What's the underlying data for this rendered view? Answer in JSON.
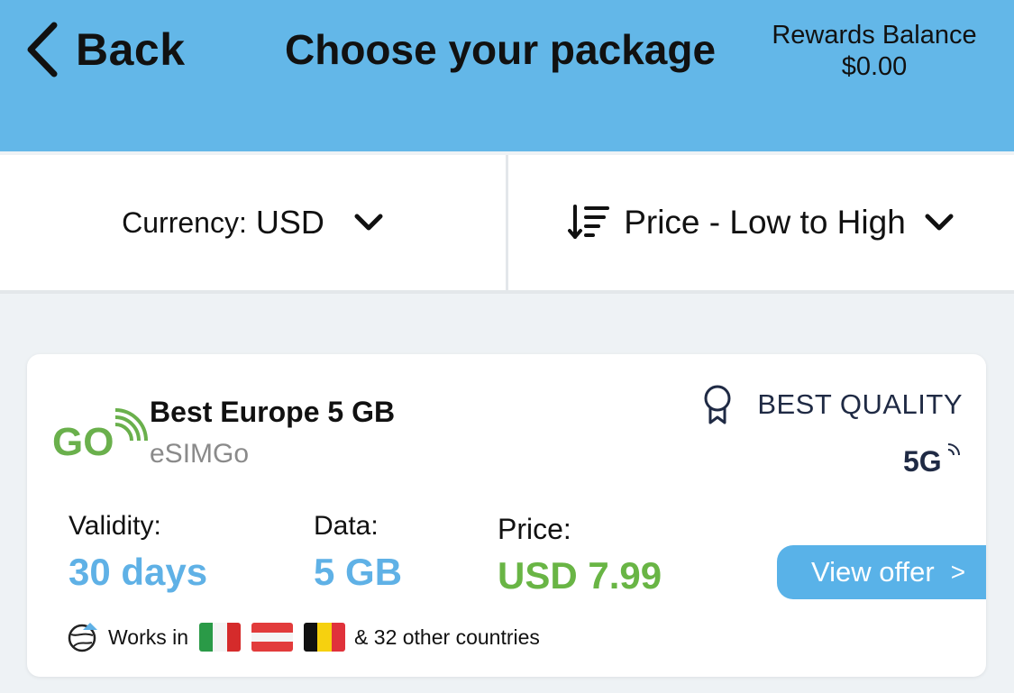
{
  "header": {
    "back_label": "Back",
    "title": "Choose your package",
    "rewards_label": "Rewards Balance",
    "rewards_value": "$0.00",
    "bg_color": "#63b7e8"
  },
  "filters": {
    "currency_label": "Currency:",
    "currency_value": "USD",
    "sort_value": "Price - Low to High"
  },
  "card": {
    "plan_name": "Best Europe 5 GB",
    "provider": "eSIMGo",
    "logo_text": "GO",
    "badge": "BEST QUALITY",
    "network": "5G",
    "validity_label": "Validity:",
    "validity_value": "30 days",
    "data_label": "Data:",
    "data_value": "5 GB",
    "price_label": "Price:",
    "price_value": "USD 7.99",
    "cta_label": "View offer",
    "cta_arrow": ">",
    "works_in_label": "Works in",
    "flags": [
      "Italy",
      "Austria",
      "Belgium"
    ],
    "other_countries": "& 32 other countries",
    "accent_blue": "#5fb1e6",
    "accent_green": "#69b545"
  }
}
